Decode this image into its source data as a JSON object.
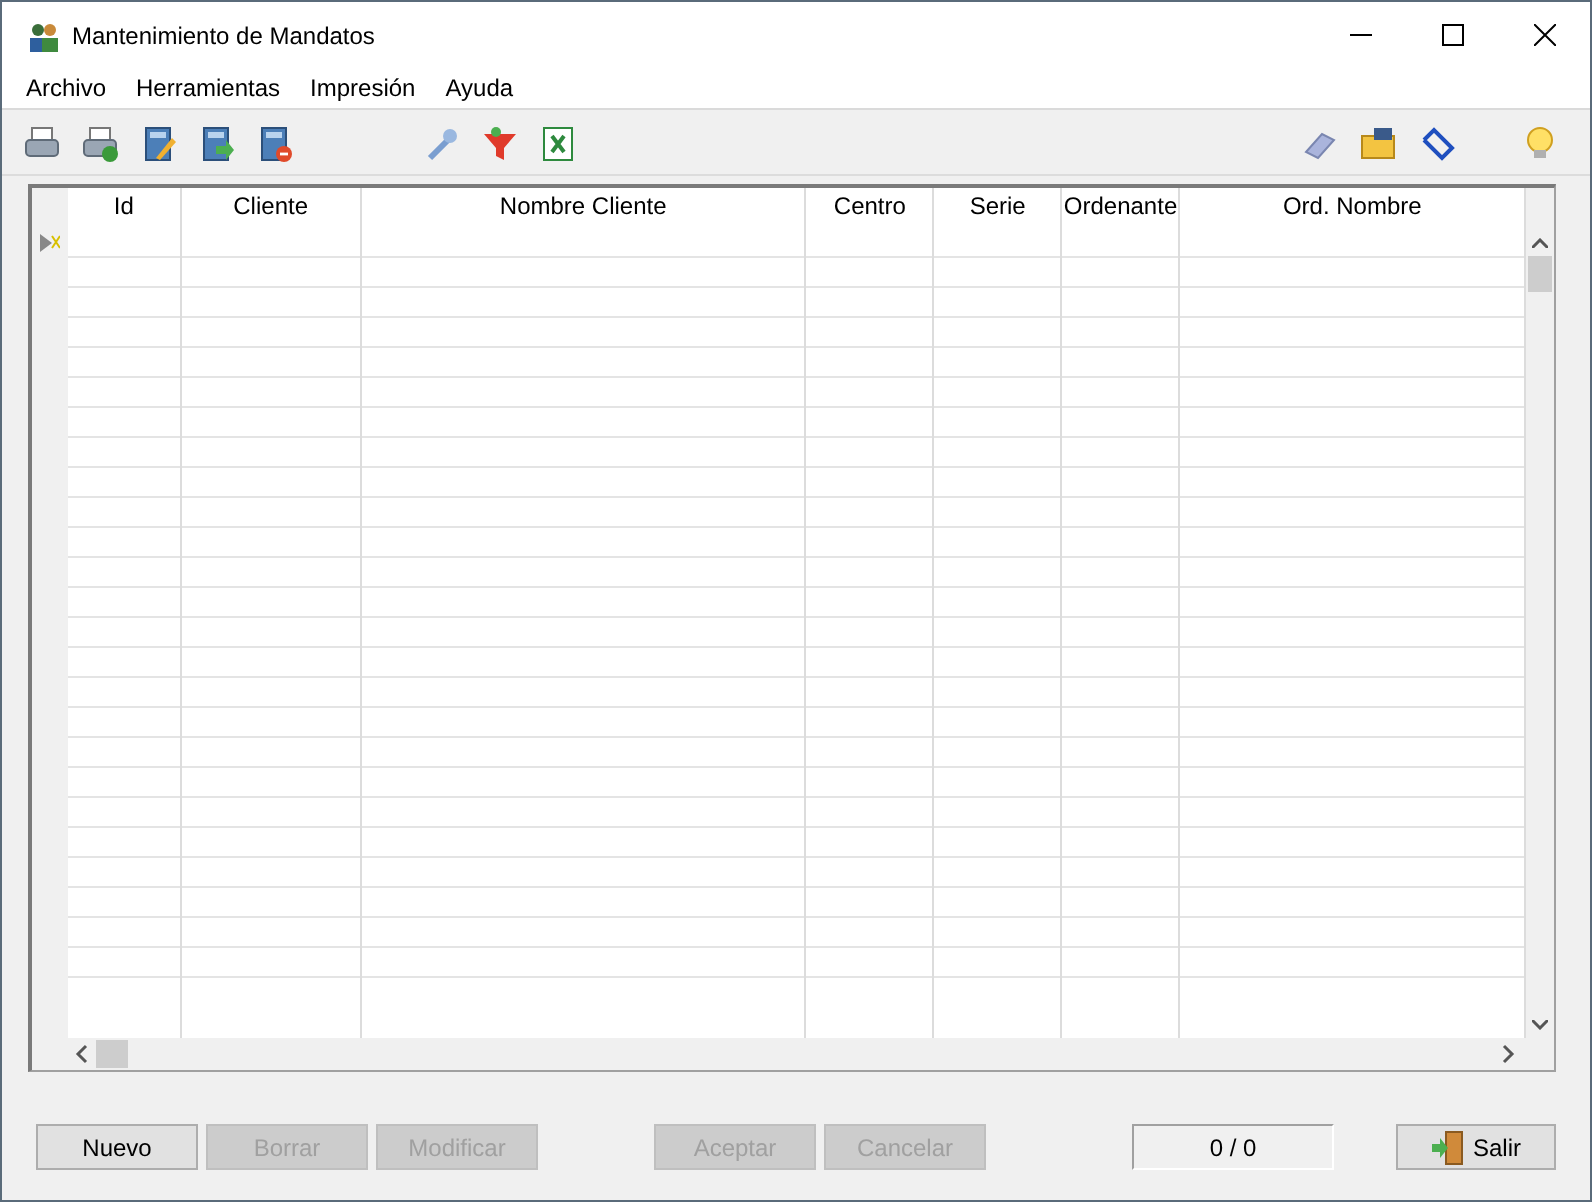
{
  "window": {
    "title": "Mantenimiento de Mandatos"
  },
  "menu": [
    "Archivo",
    "Herramientas",
    "Impresión",
    "Ayuda"
  ],
  "table": {
    "columns": [
      "Id",
      "Cliente",
      "Nombre Cliente",
      "Centro",
      "Serie",
      "Ordenante",
      "Ord. Nombre"
    ]
  },
  "buttons": [
    {
      "label": "Nuevo",
      "disabled": false
    },
    {
      "label": "Borrar",
      "disabled": true
    },
    {
      "label": "Modificar",
      "disabled": true
    },
    {
      "label": "Aceptar",
      "disabled": true
    },
    {
      "label": "Cancelar",
      "disabled": true
    }
  ],
  "counter": "0 / 0",
  "exit_button": {
    "label": "Salir"
  }
}
